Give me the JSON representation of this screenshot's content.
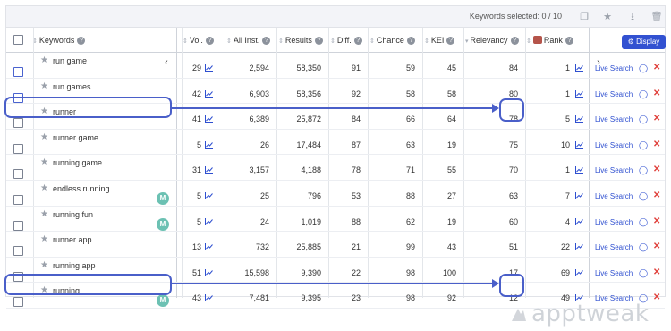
{
  "toolbar": {
    "selected_label": "Keywords selected:",
    "selected_count": "0 / 10"
  },
  "columns": {
    "keywords": "Keywords",
    "vol": "Vol.",
    "all_inst": "All Inst.",
    "results": "Results",
    "diff": "Diff.",
    "chance": "Chance",
    "kei": "KEI",
    "relevancy": "Relevancy",
    "rank": "Rank"
  },
  "display_button": "Display",
  "row_actions": {
    "live_search": "Live Search"
  },
  "rows": [
    {
      "keyword": "run game",
      "badge": "",
      "vol": "29",
      "all_inst": "2,594",
      "results": "58,350",
      "diff": "91",
      "chance": "59",
      "kei": "45",
      "relevancy": "84",
      "rank": "1"
    },
    {
      "keyword": "run games",
      "badge": "",
      "vol": "42",
      "all_inst": "6,903",
      "results": "58,356",
      "diff": "92",
      "chance": "58",
      "kei": "58",
      "relevancy": "80",
      "rank": "1"
    },
    {
      "keyword": "runner",
      "badge": "",
      "vol": "41",
      "all_inst": "6,389",
      "results": "25,872",
      "diff": "84",
      "chance": "66",
      "kei": "64",
      "relevancy": "78",
      "rank": "5"
    },
    {
      "keyword": "runner game",
      "badge": "",
      "vol": "5",
      "all_inst": "26",
      "results": "17,484",
      "diff": "87",
      "chance": "63",
      "kei": "19",
      "relevancy": "75",
      "rank": "10"
    },
    {
      "keyword": "running game",
      "badge": "",
      "vol": "31",
      "all_inst": "3,157",
      "results": "4,188",
      "diff": "78",
      "chance": "71",
      "kei": "55",
      "relevancy": "70",
      "rank": "1"
    },
    {
      "keyword": "endless running",
      "badge": "M",
      "vol": "5",
      "all_inst": "25",
      "results": "796",
      "diff": "53",
      "chance": "88",
      "kei": "27",
      "relevancy": "63",
      "rank": "7"
    },
    {
      "keyword": "running fun",
      "badge": "M",
      "vol": "5",
      "all_inst": "24",
      "results": "1,019",
      "diff": "88",
      "chance": "62",
      "kei": "19",
      "relevancy": "60",
      "rank": "4"
    },
    {
      "keyword": "runner app",
      "badge": "",
      "vol": "13",
      "all_inst": "732",
      "results": "25,885",
      "diff": "21",
      "chance": "99",
      "kei": "43",
      "relevancy": "51",
      "rank": "22"
    },
    {
      "keyword": "running app",
      "badge": "",
      "vol": "51",
      "all_inst": "15,598",
      "results": "9,390",
      "diff": "22",
      "chance": "98",
      "kei": "100",
      "relevancy": "17",
      "rank": "69"
    },
    {
      "keyword": "running",
      "badge": "M",
      "vol": "43",
      "all_inst": "7,481",
      "results": "9,395",
      "diff": "23",
      "chance": "98",
      "kei": "92",
      "relevancy": "12",
      "rank": "49"
    }
  ],
  "watermark": "apptweak",
  "colors": {
    "accent": "#3251d1",
    "highlight": "#4a5fc9",
    "badge": "#6cc1b3",
    "delete": "#e0413c"
  }
}
